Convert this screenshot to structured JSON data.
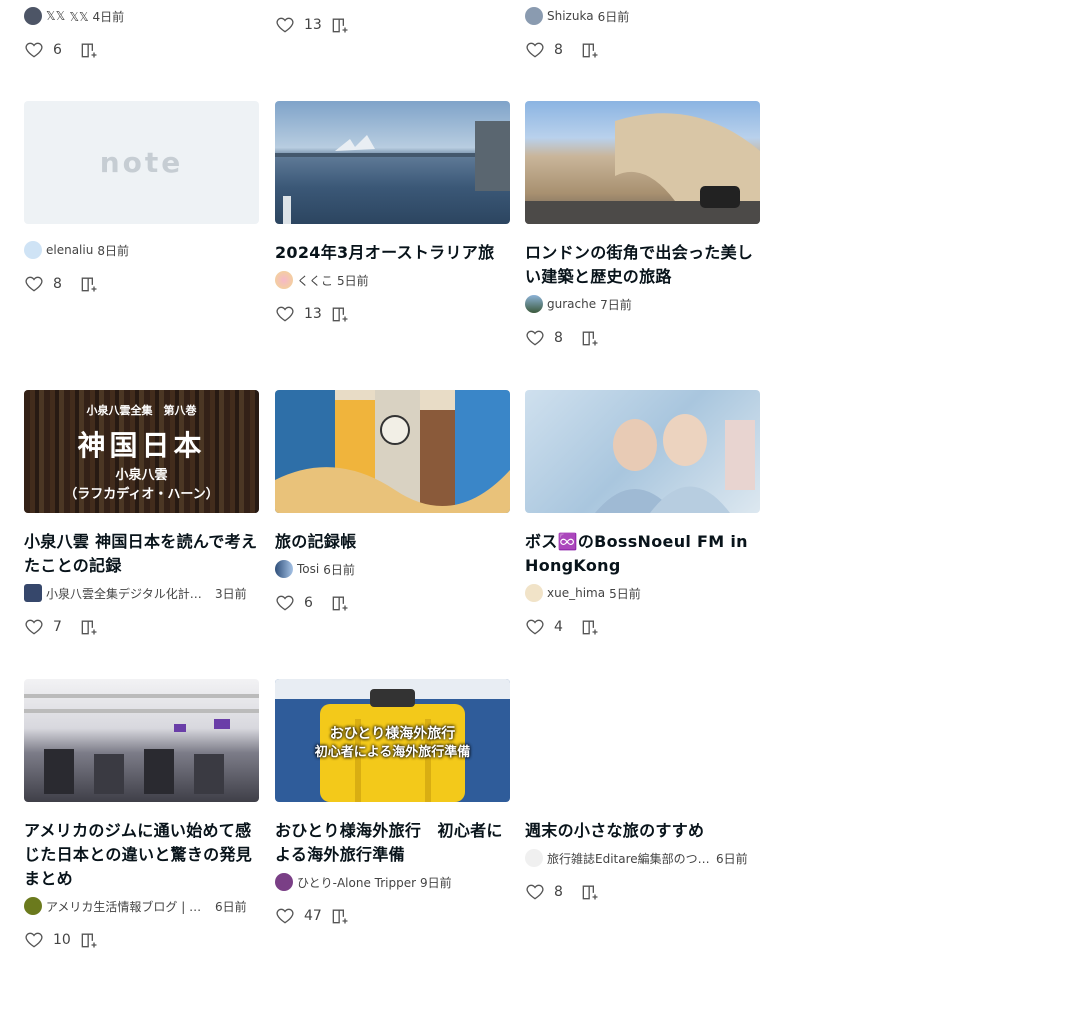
{
  "top_partial": [
    {
      "creator": "𝕏𝕏",
      "ago": "𝕏𝕏 4日前",
      "likes": "6"
    },
    {
      "likes": "13"
    },
    {
      "creator": "Shizuka",
      "ago": "6日前",
      "likes": "8"
    }
  ],
  "cards": [
    {
      "title": "",
      "creator": "elenaliu",
      "ago": "8日前",
      "likes": "8",
      "thumb_text": "note"
    },
    {
      "title": "2024年3月オーストラリア旅",
      "creator": "くくこ",
      "ago": "5日前",
      "likes": "13"
    },
    {
      "title": "ロンドンの街角で出会った美しい建築と歴史の旅路",
      "creator": "gurache",
      "ago": "7日前",
      "likes": "8"
    },
    {
      "title": "小泉八雲 神国日本を読んで考えたことの記録",
      "creator": "小泉八雲全集デジタル化計画 編集部",
      "ago": "3日前",
      "likes": "7",
      "thumb_top": "小泉八雲全集　第八巻",
      "thumb_main": "神国日本",
      "thumb_sub": "小泉八雲",
      "thumb_sub2": "（ラフカディオ・ハーン）"
    },
    {
      "title": "旅の記録帳",
      "creator": "Tosi",
      "ago": "6日前",
      "likes": "6"
    },
    {
      "title": "ボス♾️のBossNoeul FM in HongKong",
      "creator": "xue_hima",
      "ago": "5日前",
      "likes": "4"
    },
    {
      "title": "アメリカのジムに通い始めて感じた日本との違いと驚きの発見まとめ",
      "creator": "アメリカ生活情報ブログ | 海外移住 | ワーホリ情報まとめ",
      "ago": "6日前",
      "likes": "10"
    },
    {
      "title": "おひとり様海外旅行　初心者による海外旅行準備",
      "creator": "ひとり-Alone Tripper",
      "ago": "9日前",
      "likes": "47",
      "thumb_top": "おひとり様海外旅行",
      "thumb_main": "初心者による海外旅行準備"
    },
    {
      "title": "週末の小さな旅のすすめ",
      "creator": "旅行雑誌Editare編集部のつぶやき",
      "ago": "6日前",
      "likes": "8"
    }
  ]
}
